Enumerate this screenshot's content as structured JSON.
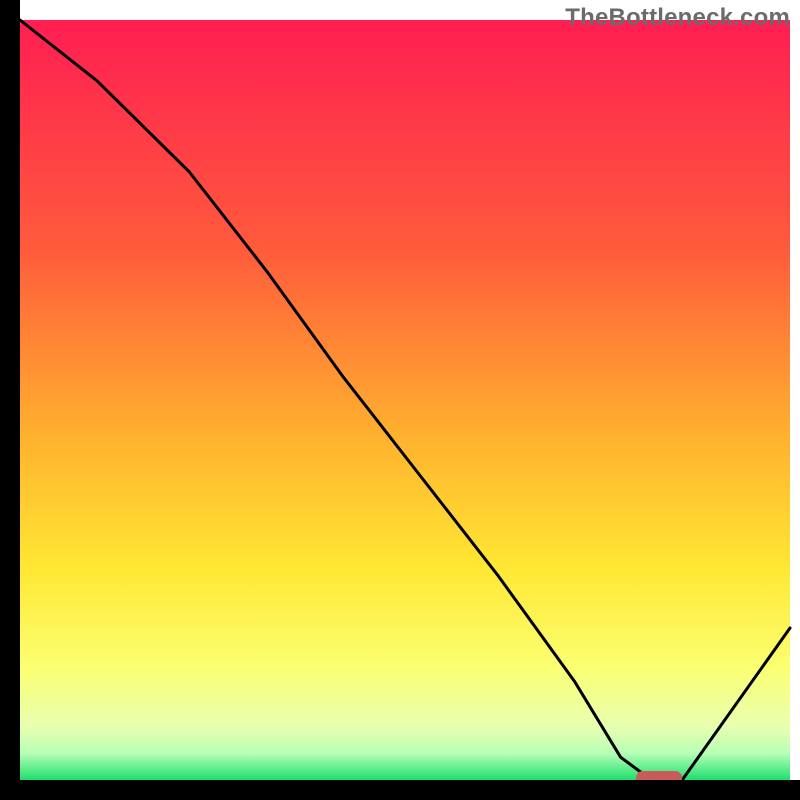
{
  "watermark": "TheBottleneck.com",
  "chart_data": {
    "type": "line",
    "title": "",
    "xlabel": "",
    "ylabel": "",
    "xlim": [
      0,
      100
    ],
    "ylim": [
      0,
      100
    ],
    "series": [
      {
        "name": "curve",
        "x": [
          0,
          10,
          22,
          32,
          42,
          52,
          62,
          72,
          78,
          82,
          86,
          100
        ],
        "values": [
          100,
          92,
          80,
          67,
          53,
          40,
          27,
          13,
          3,
          0,
          0,
          20
        ]
      }
    ],
    "marker": {
      "x_start": 80,
      "x_end": 86,
      "y": 0
    },
    "gradient_stops": [
      {
        "offset": 0.0,
        "color": "#ff1e52"
      },
      {
        "offset": 0.3,
        "color": "#ff5a3c"
      },
      {
        "offset": 0.55,
        "color": "#ffb22e"
      },
      {
        "offset": 0.72,
        "color": "#ffe733"
      },
      {
        "offset": 0.85,
        "color": "#fbff70"
      },
      {
        "offset": 0.93,
        "color": "#e8ffb0"
      },
      {
        "offset": 0.965,
        "color": "#b6ffb6"
      },
      {
        "offset": 1.0,
        "color": "#1fdf6e"
      }
    ],
    "axes_color": "#000000",
    "curve_color": "#000000",
    "marker_color": "#c85c5c"
  }
}
